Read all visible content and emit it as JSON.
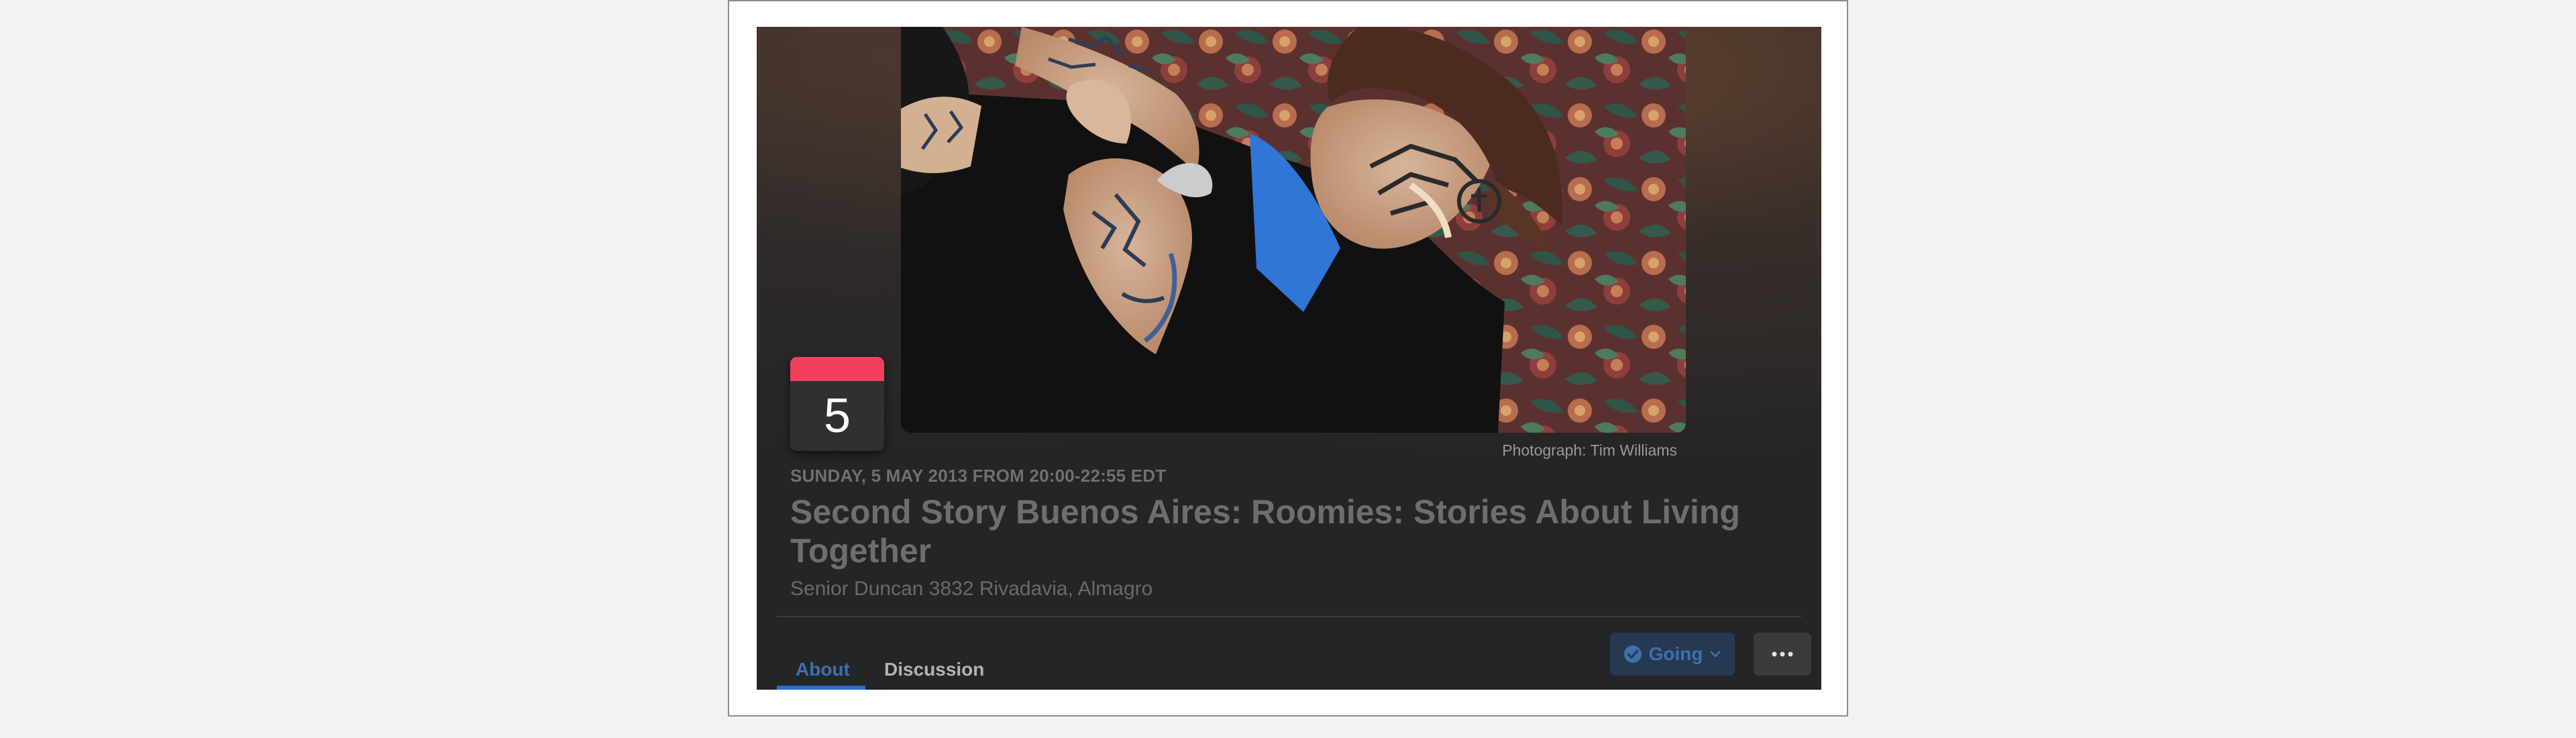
{
  "event": {
    "date_day": "5",
    "date_line": "SUNDAY, 5 MAY 2013 FROM 20:00-22:55 EDT",
    "title": "Second Story Buenos Aires: Roomies: Stories About Living Together",
    "location": "Senior Duncan 3832 Rivadavia, Almagro",
    "photo_credit": "Photograph: Tim Williams"
  },
  "tabs": {
    "about": "About",
    "discussion": "Discussion"
  },
  "actions": {
    "going": "Going",
    "more_icon": "more-horizontal-icon"
  },
  "colors": {
    "accent": "#2d6ad6",
    "calendar_red": "#f0405e",
    "card_background": "#242526",
    "going_button": "#263951"
  },
  "icons": {
    "check": "check-circle-icon",
    "chevron": "chevron-down-icon"
  }
}
